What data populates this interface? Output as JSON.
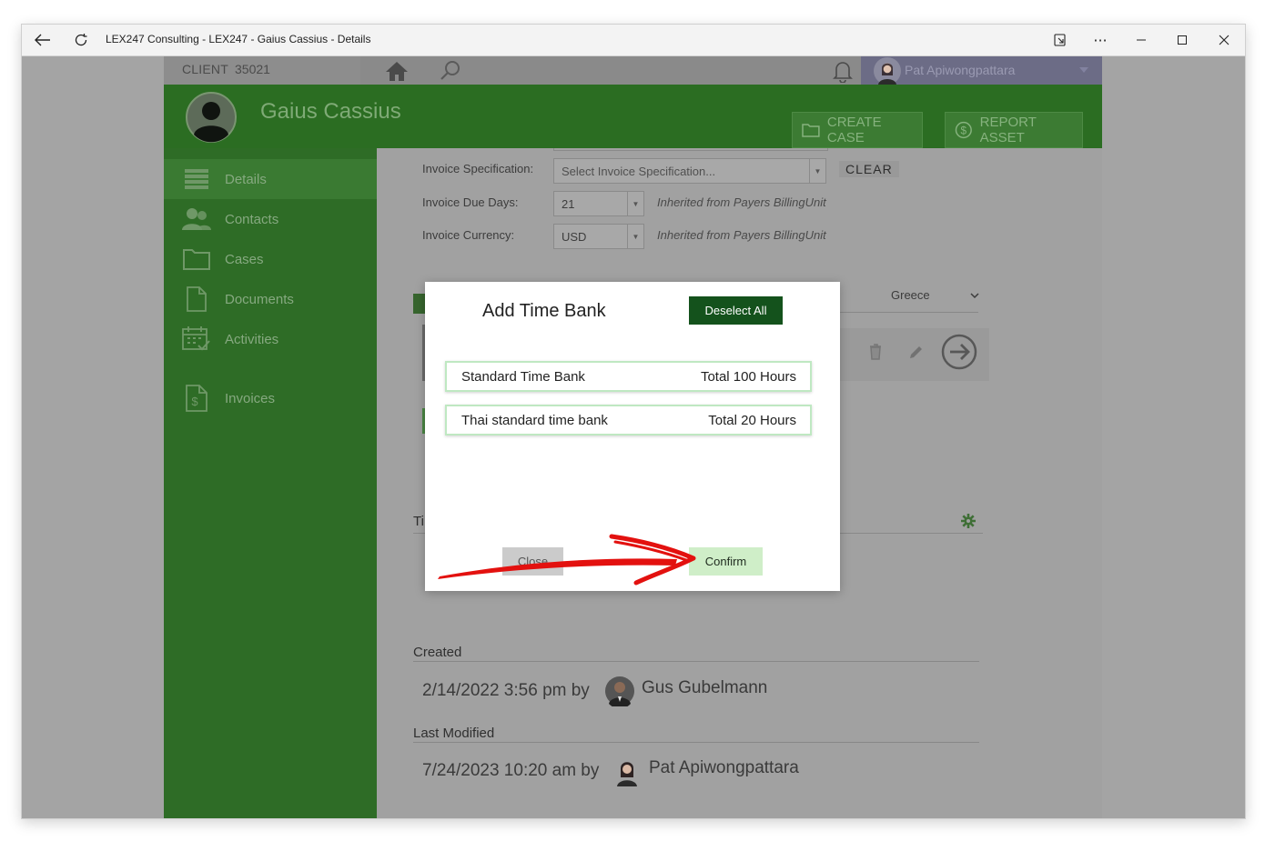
{
  "window": {
    "title": "LEX247 Consulting - LEX247 - Gaius Cassius - Details"
  },
  "topbar": {
    "client_label": "CLIENT",
    "client_number": "35021",
    "user_name": "Pat Apiwongpattara"
  },
  "header": {
    "client_name": "Gaius Cassius",
    "create_case_label": "CREATE CASE",
    "report_asset_label": "REPORT ASSET"
  },
  "sidebar": {
    "items": [
      {
        "label": "Details",
        "icon": "details-list-icon",
        "active": true
      },
      {
        "label": "Contacts",
        "icon": "contacts-icon"
      },
      {
        "label": "Cases",
        "icon": "folder-icon"
      },
      {
        "label": "Documents",
        "icon": "document-icon"
      },
      {
        "label": "Activities",
        "icon": "calendar-icon"
      },
      {
        "label": "Invoices",
        "icon": "invoice-icon"
      }
    ]
  },
  "form": {
    "invoice_spec_label": "Invoice Specification:",
    "invoice_spec_placeholder": "Select Invoice Specification...",
    "clear_label": "CLEAR",
    "due_days_label": "Invoice Due Days:",
    "due_days_value": "21",
    "due_days_note": "Inherited from Payers BillingUnit",
    "currency_label": "Invoice Currency:",
    "currency_value": "USD",
    "currency_note": "Inherited from Payers BillingUnit",
    "country_value": "Greece",
    "section_partial": "Ti"
  },
  "meta": {
    "created_title": "Created",
    "created_text": "2/14/2022 3:56 pm by",
    "created_user": "Gus Gubelmann",
    "modified_title": "Last Modified",
    "modified_text": "7/24/2023 10:20 am by",
    "modified_user": "Pat Apiwongpattara"
  },
  "modal": {
    "title": "Add Time Bank",
    "deselect_label": "Deselect All",
    "items": [
      {
        "name": "Standard Time Bank",
        "total": "Total 100 Hours"
      },
      {
        "name": "Thai standard time bank",
        "total": "Total 20 Hours"
      }
    ],
    "close_label": "Close",
    "confirm_label": "Confirm"
  },
  "colors": {
    "brand_green": "#2b6d22",
    "dark_button": "#14521c",
    "confirm_bg": "#cfeec8",
    "annotation_red": "#e3110f"
  }
}
